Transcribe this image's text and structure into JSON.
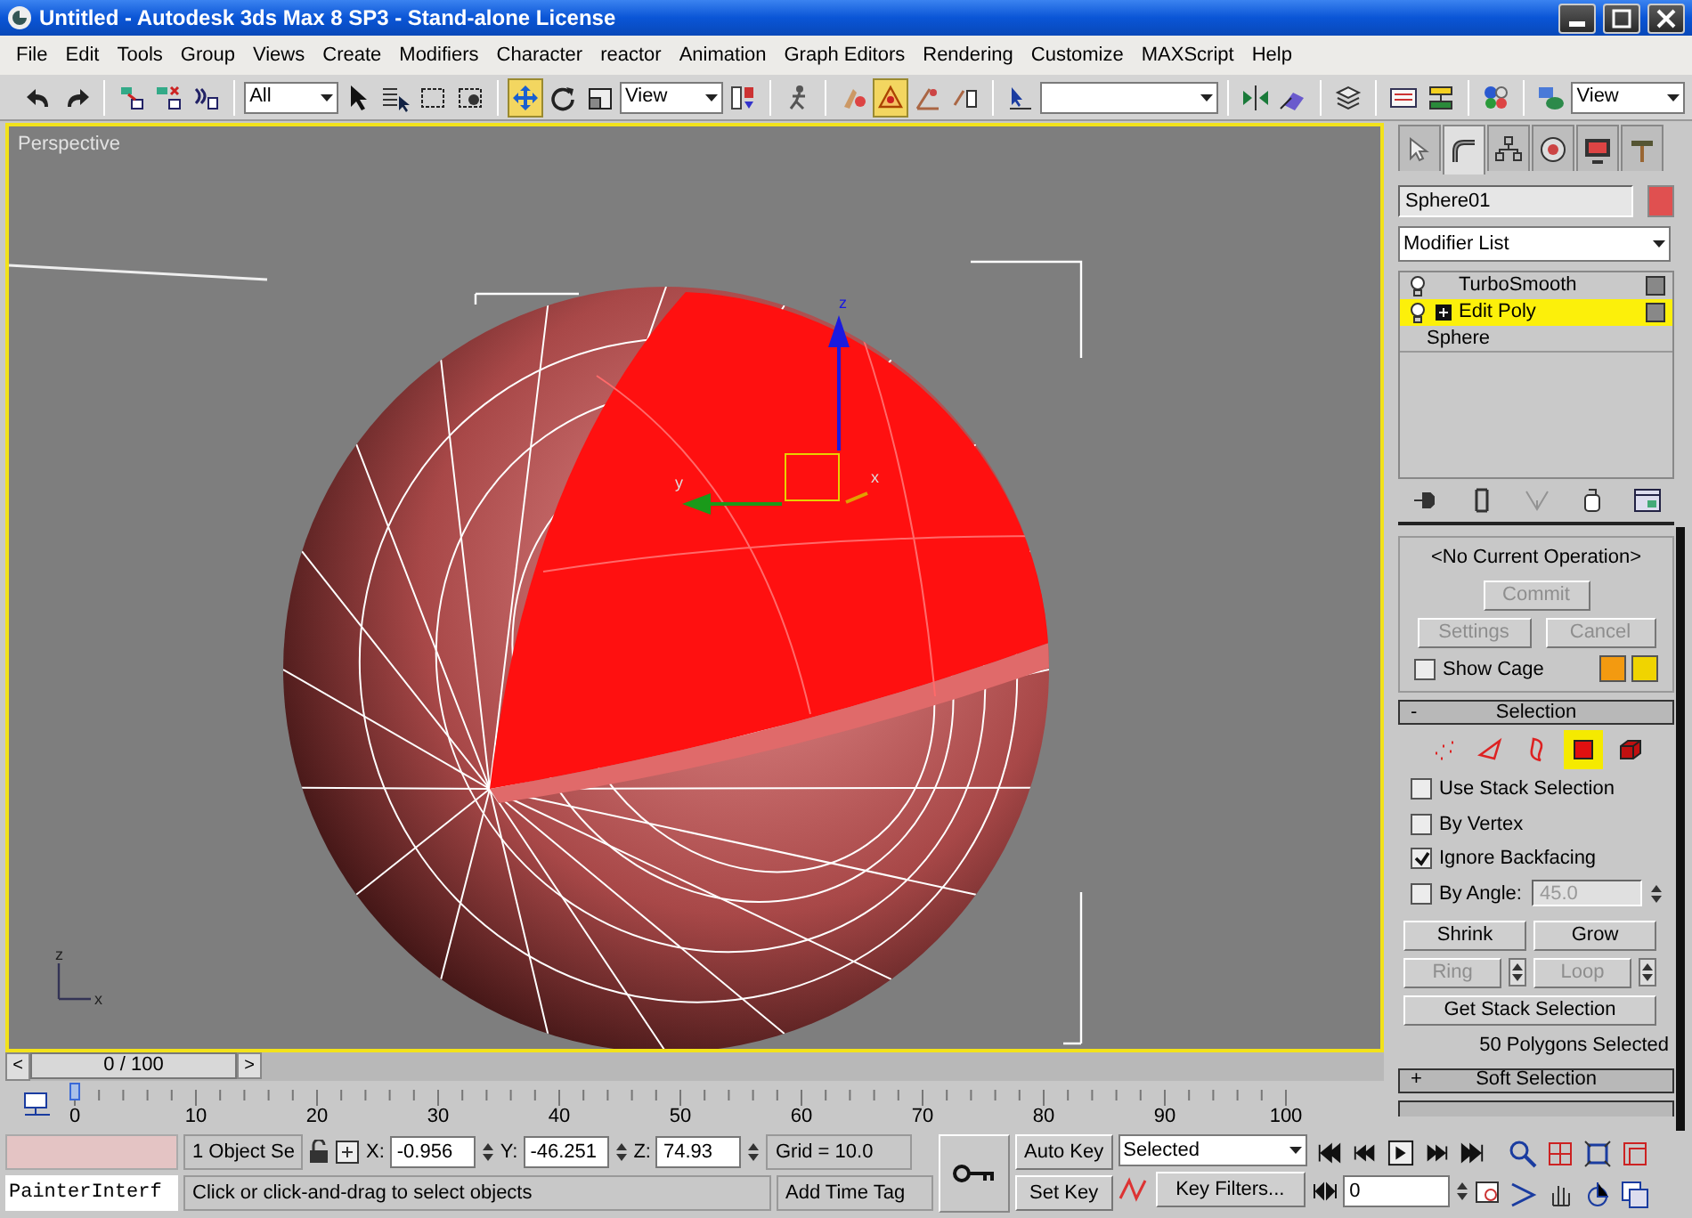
{
  "window": {
    "title": "Untitled - Autodesk 3ds Max 8 SP3  - Stand-alone License"
  },
  "menu": [
    "File",
    "Edit",
    "Tools",
    "Group",
    "Views",
    "Create",
    "Modifiers",
    "Character",
    "reactor",
    "Animation",
    "Graph Editors",
    "Rendering",
    "Customize",
    "MAXScript",
    "Help"
  ],
  "main_toolbar": [
    {
      "kind": "button",
      "selected": false
    },
    {
      "kind": "button",
      "selected": false
    },
    {
      "kind": "separator"
    },
    {
      "kind": "button",
      "selected": false
    },
    {
      "kind": "button",
      "selected": false
    },
    {
      "kind": "button",
      "selected": false
    },
    {
      "kind": "separator"
    },
    {
      "kind": "dropdown",
      "value": "All"
    },
    {
      "kind": "button",
      "selected": false
    },
    {
      "kind": "button",
      "selected": false
    },
    {
      "kind": "button",
      "selected": false
    },
    {
      "kind": "button",
      "selected": false
    },
    {
      "kind": "separator"
    },
    {
      "kind": "button",
      "selected": true
    },
    {
      "kind": "button",
      "selected": false
    },
    {
      "kind": "button",
      "selected": false
    },
    {
      "kind": "dropdown",
      "value": "View"
    },
    {
      "kind": "button",
      "selected": false
    },
    {
      "kind": "separator"
    },
    {
      "kind": "button",
      "selected": false
    },
    {
      "kind": "separator"
    },
    {
      "kind": "button",
      "selected": false
    },
    {
      "kind": "button",
      "selected": true
    },
    {
      "kind": "button",
      "selected": false
    },
    {
      "kind": "button",
      "selected": false
    },
    {
      "kind": "separator"
    },
    {
      "kind": "button",
      "selected": false
    },
    {
      "kind": "dropdown"
    },
    {
      "kind": "separator"
    },
    {
      "kind": "button",
      "selected": false
    },
    {
      "kind": "button",
      "selected": false
    },
    {
      "kind": "separator"
    },
    {
      "kind": "button",
      "selected": false
    },
    {
      "kind": "separator"
    },
    {
      "kind": "button",
      "selected": false
    },
    {
      "kind": "button",
      "selected": false
    },
    {
      "kind": "separator"
    },
    {
      "kind": "button",
      "selected": false
    },
    {
      "kind": "separator"
    },
    {
      "kind": "button",
      "selected": false
    },
    {
      "kind": "dropdown",
      "value": "View"
    }
  ],
  "viewport": {
    "label": "Perspective",
    "gizmo_labels": [
      "z",
      "y",
      "x"
    ],
    "corner_axis_labels": [
      "z",
      "x"
    ]
  },
  "command_panel": {
    "tabs": [
      {
        "selected": false
      },
      {
        "selected": true
      },
      {
        "selected": false
      },
      {
        "selected": false
      },
      {
        "selected": false
      },
      {
        "selected": false
      }
    ],
    "object_name": "Sphere01",
    "modifier_list": "Modifier List",
    "stack": [
      {
        "label": "TurboSmooth",
        "kind": "modifier",
        "selected": false,
        "expandable": false
      },
      {
        "label": "Edit Poly",
        "kind": "modifier",
        "selected": true,
        "expandable": true
      },
      {
        "label": "Sphere",
        "kind": "base",
        "selected": false,
        "expandable": false
      }
    ],
    "stack_tools": [
      {
        "disabled": false
      },
      {
        "disabled": false
      },
      {
        "disabled": true
      },
      {
        "disabled": false
      },
      {
        "disabled": false
      }
    ],
    "edit_poly": {
      "operation": "<No Current Operation>",
      "buttons": [
        {
          "label": "Commit",
          "disabled": true
        },
        {
          "label": "Settings",
          "disabled": true
        },
        {
          "label": "Cancel",
          "disabled": true
        }
      ],
      "show_cage": {
        "label": "Show Cage",
        "checked": false
      }
    },
    "rollouts": [
      {
        "toggle": "-",
        "title": "Selection"
      },
      {
        "toggle": "+",
        "title": "Soft Selection"
      }
    ],
    "selection": {
      "levels": [
        {
          "selected": false
        },
        {
          "selected": false
        },
        {
          "selected": false
        },
        {
          "selected": true
        },
        {
          "selected": false
        }
      ],
      "options": [
        {
          "label": "Use Stack Selection",
          "checked": false
        },
        {
          "label": "By Vertex",
          "checked": false
        },
        {
          "label": "Ignore Backfacing",
          "checked": true
        },
        {
          "label": "By Angle:",
          "checked": false,
          "value": "45.0",
          "disabled": true
        }
      ],
      "buttons": [
        {
          "label": "Shrink",
          "kind": "plain",
          "disabled": false
        },
        {
          "label": "Grow",
          "kind": "plain",
          "disabled": false
        },
        {
          "label": "Ring",
          "kind": "spinner",
          "disabled": true
        },
        {
          "label": "Loop",
          "kind": "spinner",
          "disabled": true
        },
        {
          "label": "Get Stack Selection",
          "kind": "wide",
          "disabled": false
        }
      ],
      "status": "50 Polygons Selected"
    }
  },
  "time_slider": {
    "prev": "<",
    "thumb": "0 / 100",
    "next": ">",
    "level": 0
  },
  "track_bar": {
    "labels": [
      "0",
      "10",
      "20",
      "30",
      "40",
      "50",
      "60",
      "70",
      "80",
      "90",
      "100"
    ]
  },
  "status_bar": {
    "listener": "PainterInterf",
    "selection_count": "1 Object Se",
    "coords": [
      {
        "axis": "X:",
        "value": "-0.956"
      },
      {
        "axis": "Y:",
        "value": "-46.251"
      },
      {
        "axis": "Z:",
        "value": "74.93"
      }
    ],
    "grid": "Grid = 10.0",
    "prompt": "Click or click-and-drag to select objects",
    "time_tag": "Add Time Tag",
    "auto_key": {
      "label": "Auto Key",
      "on": false
    },
    "set_key": "Set Key",
    "key_set": "Selected",
    "key_filters": "Key Filters...",
    "frame": "0"
  }
}
